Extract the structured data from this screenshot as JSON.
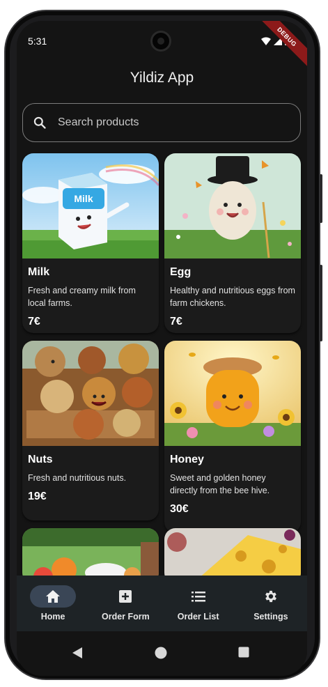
{
  "status_bar": {
    "time": "5:31",
    "debug_label": "DEBUG"
  },
  "app_bar": {
    "title": "Yildiz App"
  },
  "search": {
    "placeholder": "Search products"
  },
  "products": [
    {
      "name": "Milk",
      "description": "Fresh and creamy milk from local farms.",
      "price": "7€",
      "image": "milk-carton-cartoon"
    },
    {
      "name": "Egg",
      "description": "Healthy and nutritious eggs from farm chickens.",
      "price": "7€",
      "image": "egg-character-cartoon"
    },
    {
      "name": "Nuts",
      "description": "Fresh and nutritious nuts.",
      "price": "19€",
      "image": "nuts-crate-cartoon"
    },
    {
      "name": "Honey",
      "description": "Sweet and golden honey directly from the bee hive.",
      "price": "30€",
      "image": "honey-jar-cartoon"
    }
  ],
  "partial_products": [
    {
      "image": "fruit-picnic"
    },
    {
      "image": "cheese-wedge"
    }
  ],
  "bottom_nav": {
    "items": [
      {
        "label": "Home",
        "icon": "home-icon",
        "active": true
      },
      {
        "label": "Order Form",
        "icon": "add-box-icon",
        "active": false
      },
      {
        "label": "Order List",
        "icon": "list-icon",
        "active": false
      },
      {
        "label": "Settings",
        "icon": "gear-icon",
        "active": false
      }
    ]
  },
  "colors": {
    "background": "#141414",
    "card": "#1b1b1b",
    "nav_bar": "#1e2326",
    "nav_active_pill": "#3a4656",
    "debug_ribbon": "#8c1a1a"
  }
}
